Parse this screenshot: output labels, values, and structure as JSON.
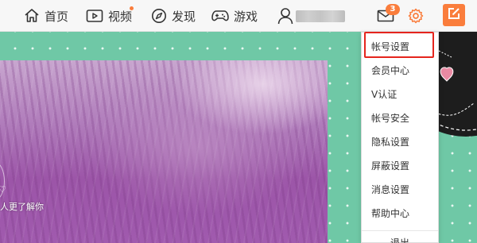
{
  "nav": {
    "home": "首页",
    "video": "视频",
    "discover": "发现",
    "games": "游戏",
    "message_count": "3"
  },
  "hero": {
    "caption": "人更了解你"
  },
  "settings_menu": {
    "items": [
      {
        "label": "帐号设置"
      },
      {
        "label": "会员中心"
      },
      {
        "label": "V认证"
      },
      {
        "label": "帐号安全"
      },
      {
        "label": "隐私设置"
      },
      {
        "label": "屏蔽设置"
      },
      {
        "label": "消息设置"
      },
      {
        "label": "帮助中心"
      }
    ],
    "logout": "退出",
    "highlighted_index": 0
  },
  "colors": {
    "accent": "#fa7d3c",
    "highlight_border": "#e5251d",
    "background_green": "#6fc8a6"
  }
}
